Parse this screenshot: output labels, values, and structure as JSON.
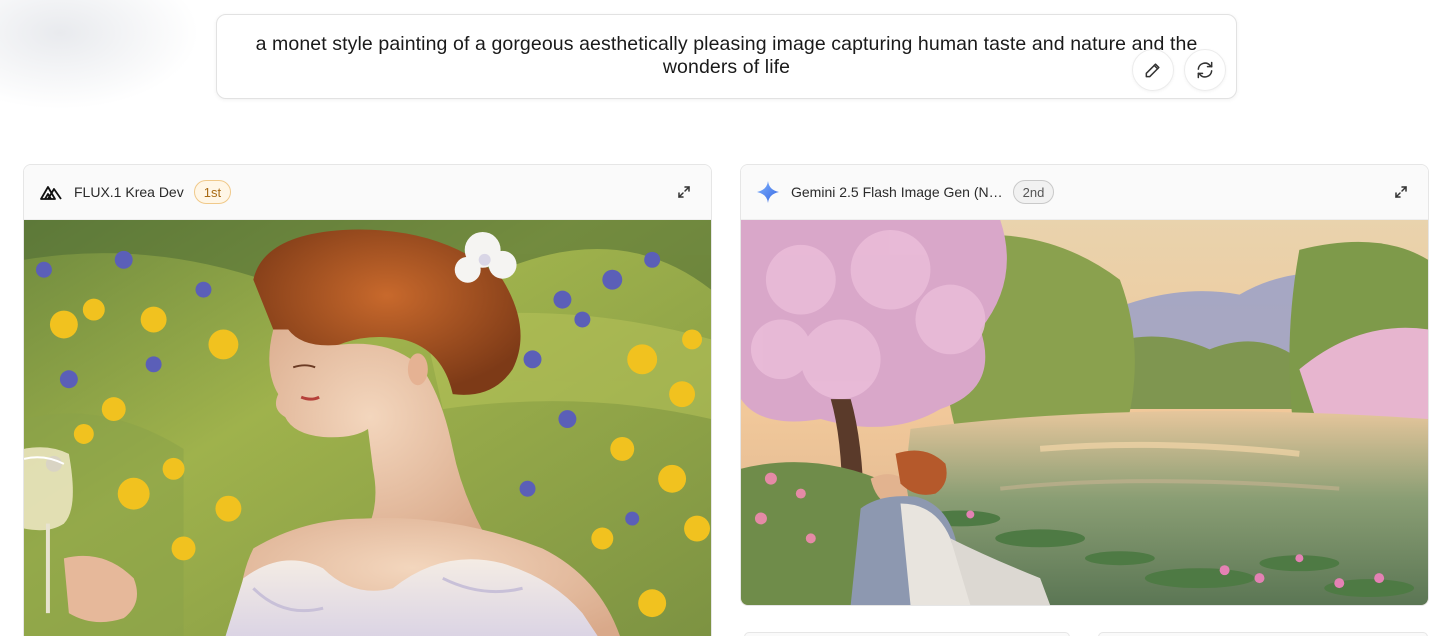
{
  "prompt": {
    "text": "a monet style painting of a gorgeous aesthetically pleasing image capturing human taste and nature and the wonders of life",
    "actions": [
      {
        "name": "edit-icon"
      },
      {
        "name": "regenerate-icon"
      }
    ]
  },
  "cards": [
    {
      "model_name": "FLUX.1 Krea Dev",
      "rank": "1st",
      "icon": "flux-logo-icon",
      "image_alt": "impressionist painting of a red-haired woman with white flower in hair among yellow and blue wildflowers holding a glass"
    },
    {
      "model_name": "Gemini 2.5 Flash Image Gen (N…",
      "rank": "2nd",
      "icon": "gemini-sparkle-icon",
      "image_alt": "impressionist painting of a woman seated by a pond with water lilies under pink blossoming trees and willows"
    }
  ],
  "colors": {
    "gold_badge": "#f0c98a",
    "silver_badge": "#c9c9c9",
    "gemini_blue": "#4a7cf0"
  }
}
